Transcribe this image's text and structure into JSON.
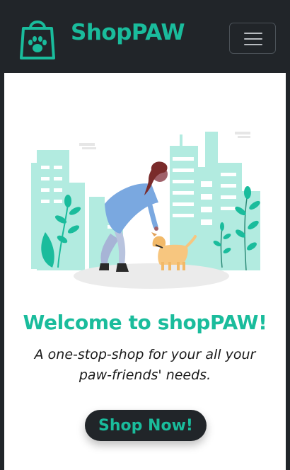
{
  "colors": {
    "accent": "#1abc9c",
    "dark": "#212529",
    "background": "#ffffff"
  },
  "navbar": {
    "logo_icon": "shopping-bag-paw-icon",
    "brand": "ShopPAW",
    "toggler_icon": "hamburger-menu-icon"
  },
  "hero": {
    "illustration": "woman-petting-dog-city-illustration",
    "title": "Welcome to shopPAW!",
    "subtitle_line1": "A one-stop-shop for your all your",
    "subtitle_line2": "paw-friends' needs.",
    "cta_label": "Shop Now!"
  }
}
